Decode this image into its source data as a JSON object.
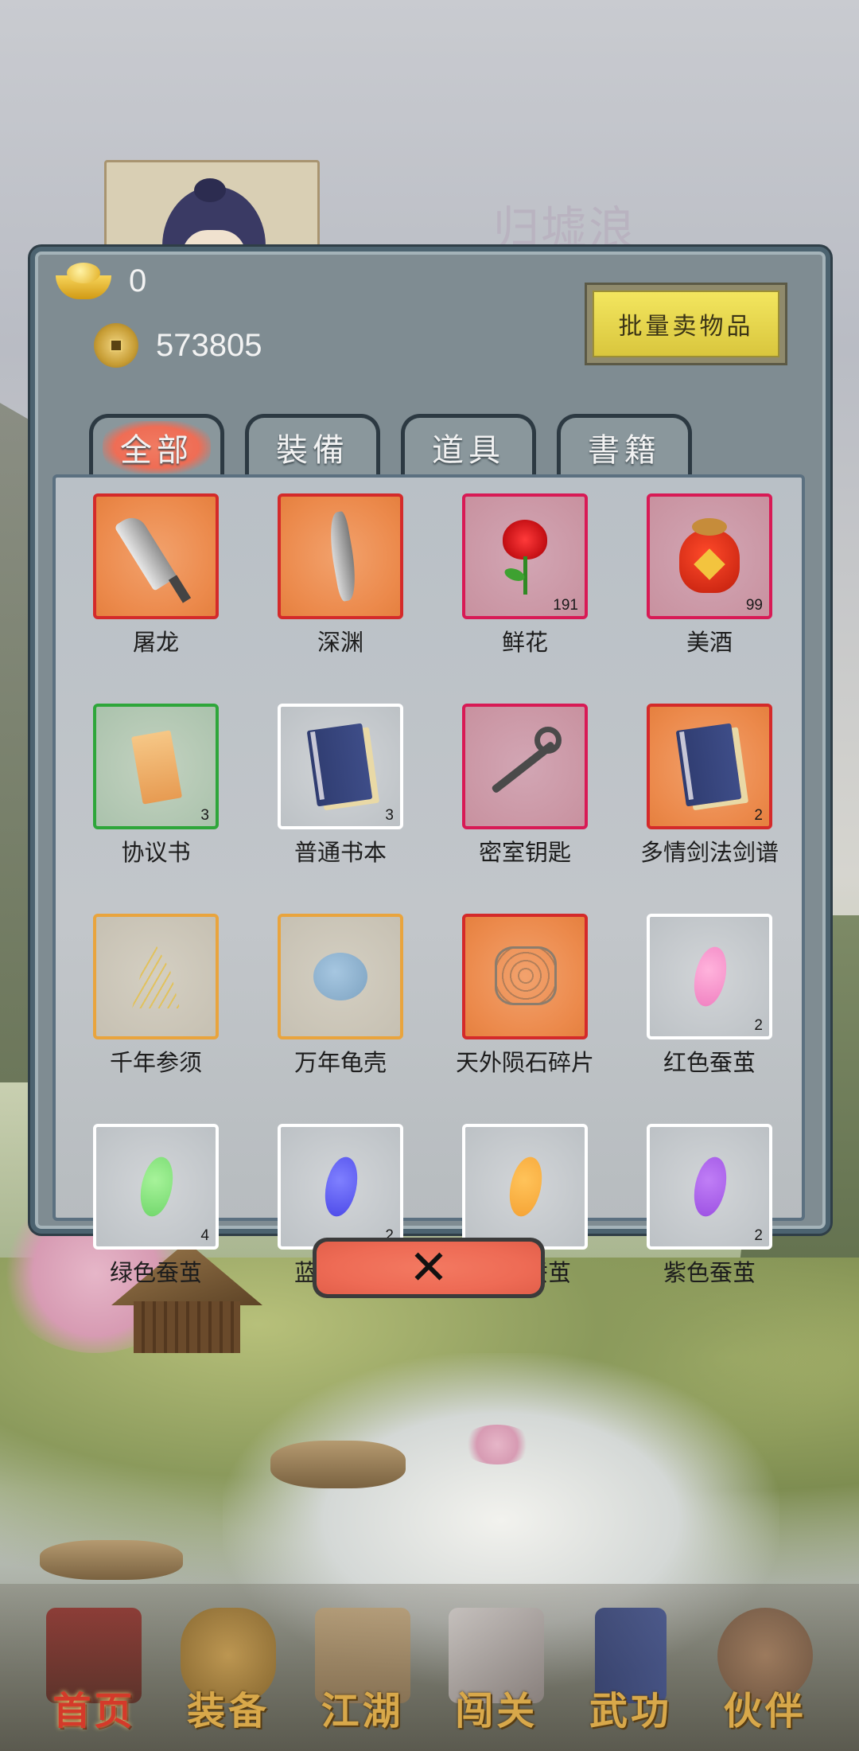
{
  "background": {
    "character_name": "归墟浪"
  },
  "currency": {
    "gold_ingot_amount": "0",
    "copper_coin_amount": "573805"
  },
  "sell_button_label": "批量卖物品",
  "tabs": [
    {
      "label": "全部",
      "active": true
    },
    {
      "label": "裝備",
      "active": false
    },
    {
      "label": "道具",
      "active": false
    },
    {
      "label": "書籍",
      "active": false
    }
  ],
  "items": [
    {
      "name": "屠龙",
      "count": "",
      "rarity": "orange",
      "icon": "broadsword-icon"
    },
    {
      "name": "深渊",
      "count": "",
      "rarity": "orange",
      "icon": "saber-icon"
    },
    {
      "name": "鲜花",
      "count": "191",
      "rarity": "pink",
      "icon": "rose-icon"
    },
    {
      "name": "美酒",
      "count": "99",
      "rarity": "pink",
      "icon": "wine-jar-icon"
    },
    {
      "name": "协议书",
      "count": "3",
      "rarity": "green",
      "icon": "contract-icon"
    },
    {
      "name": "普通书本",
      "count": "3",
      "rarity": "white",
      "icon": "book-icon"
    },
    {
      "name": "密室钥匙",
      "count": "",
      "rarity": "pink",
      "icon": "key-icon"
    },
    {
      "name": "多情剑法剑谱",
      "count": "2",
      "rarity": "orange",
      "icon": "book-icon"
    },
    {
      "name": "千年参须",
      "count": "",
      "rarity": "gold",
      "icon": "ginseng-icon"
    },
    {
      "name": "万年龟壳",
      "count": "",
      "rarity": "gold",
      "icon": "turtle-shell-icon"
    },
    {
      "name": "天外陨石碎片",
      "count": "",
      "rarity": "orange",
      "icon": "meteorite-icon"
    },
    {
      "name": "红色蚕茧",
      "count": "2",
      "rarity": "white",
      "icon": "pink-cocoon-icon"
    },
    {
      "name": "绿色蚕茧",
      "count": "4",
      "rarity": "white",
      "icon": "green-cocoon-icon"
    },
    {
      "name": "蓝色蚕茧",
      "count": "2",
      "rarity": "white",
      "icon": "blue-cocoon-icon"
    },
    {
      "name": "黄色蚕茧",
      "count": "",
      "rarity": "white",
      "icon": "yellow-cocoon-icon"
    },
    {
      "name": "紫色蚕茧",
      "count": "2",
      "rarity": "white",
      "icon": "purple-cocoon-icon"
    }
  ],
  "close_button_symbol": "✕",
  "bottom_nav": [
    {
      "label": "首页",
      "active": true,
      "icon": "house-icon"
    },
    {
      "label": "装备",
      "active": false,
      "icon": "armor-icon"
    },
    {
      "label": "江湖",
      "active": false,
      "icon": "scroll-map-icon"
    },
    {
      "label": "闯关",
      "active": false,
      "icon": "crossed-swords-icon"
    },
    {
      "label": "武功",
      "active": false,
      "icon": "manual-book-icon"
    },
    {
      "label": "伙伴",
      "active": false,
      "icon": "companions-icon"
    }
  ],
  "colors": {
    "rarity_orange_border": "#d42a2a",
    "rarity_pink_border": "#d81a55",
    "rarity_green_border": "#2ea63a",
    "rarity_white_border": "#ffffff",
    "rarity_gold_border": "#e9a43d",
    "active_tab_highlight": "#ef6d55",
    "sell_button": "#e6d64c"
  }
}
